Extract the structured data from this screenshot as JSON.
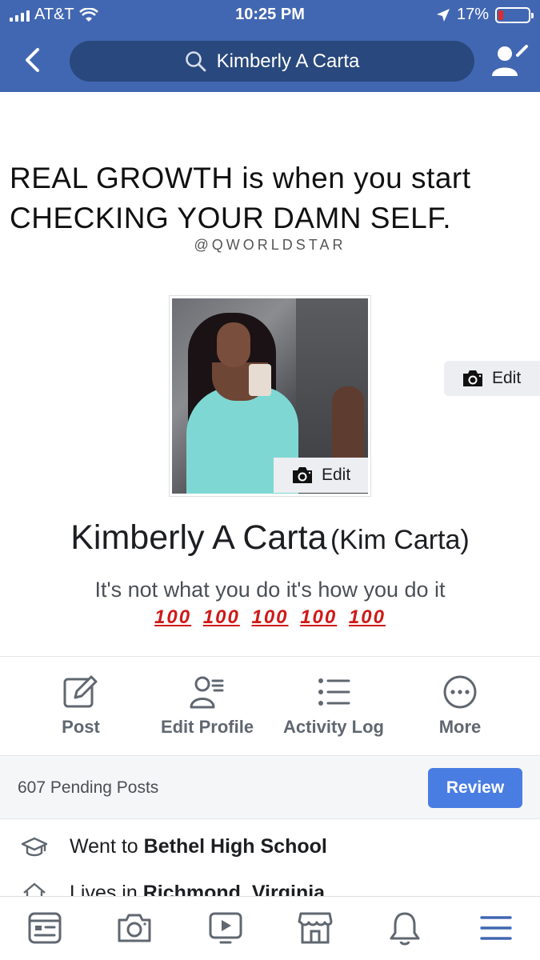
{
  "status_bar": {
    "carrier": "AT&T",
    "time": "10:25 PM",
    "battery": "17%",
    "battery_level": 0.17,
    "icons": [
      "signal-icon",
      "wifi-icon",
      "location-arrow-icon",
      "battery-icon"
    ]
  },
  "nav": {
    "search_text": "Kimberly A Carta",
    "icons": [
      "back-chevron-icon",
      "search-icon",
      "friend-settings-icon"
    ]
  },
  "cover": {
    "quote_line1": "REAL GROWTH is when you start",
    "quote_line2": "CHECKING YOUR DAMN SELF.",
    "handle": "@QWORLDSTAR",
    "edit_label": "Edit"
  },
  "profile": {
    "picture_edit_label": "Edit",
    "name": "Kimberly A Carta",
    "alternate_name": "(Kim Carta)",
    "bio": "It's not what you do it's how you do it",
    "bio_emoji": [
      "100",
      "100",
      "100",
      "100",
      "100"
    ]
  },
  "actions": [
    {
      "label": "Post",
      "icon": "compose-icon"
    },
    {
      "label": "Edit Profile",
      "icon": "edit-profile-icon"
    },
    {
      "label": "Activity Log",
      "icon": "activity-log-icon"
    },
    {
      "label": "More",
      "icon": "more-icon"
    }
  ],
  "pending": {
    "text": "607 Pending Posts",
    "button": "Review"
  },
  "info": [
    {
      "prefix": "Went to",
      "value": "Bethel High School",
      "icon": "graduation-cap-icon"
    },
    {
      "prefix": "Lives in",
      "value": "Richmond, Virginia",
      "icon": "home-icon"
    }
  ],
  "tab_bar": {
    "icons": [
      "news-feed-icon",
      "camera-icon",
      "watch-icon",
      "marketplace-icon",
      "notifications-icon",
      "menu-icon"
    ],
    "active_color": "#4267b2"
  },
  "colors": {
    "brand": "#4267b2",
    "search_bg": "#29487d",
    "review_button": "#4a7de2",
    "battery_low": "#e02b2b"
  }
}
